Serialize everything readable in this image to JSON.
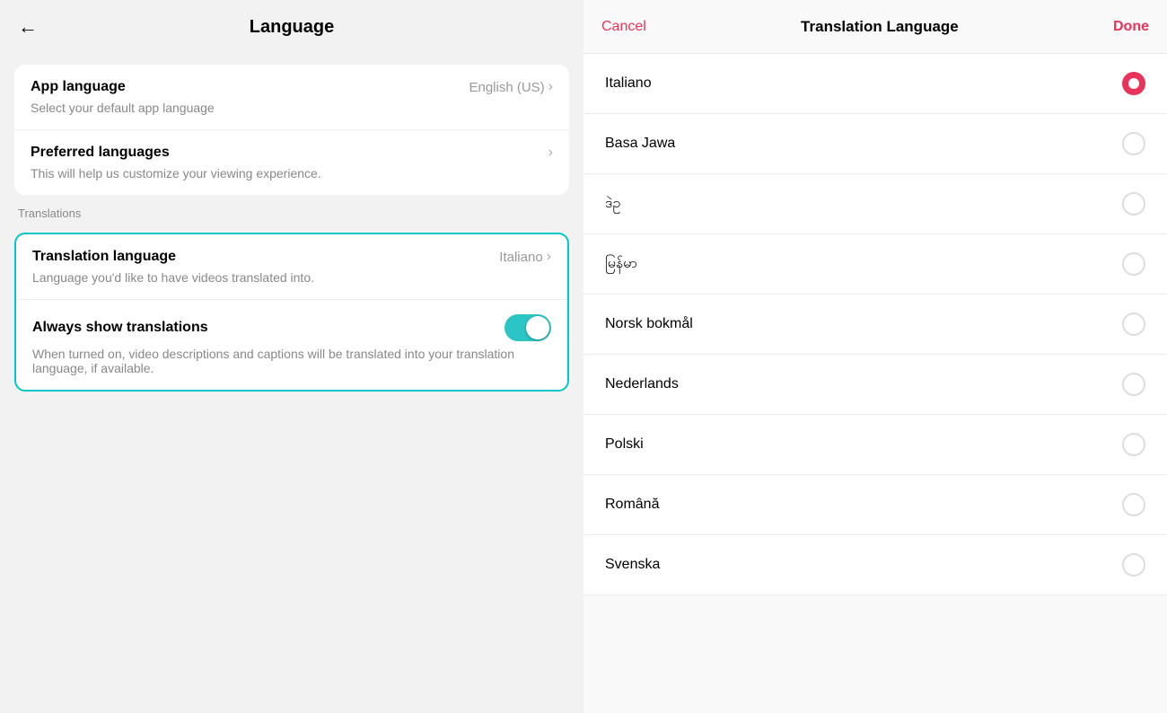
{
  "left": {
    "header": {
      "back_icon": "←",
      "title": "Language"
    },
    "app_language_card": {
      "title": "App language",
      "value": "English (US)",
      "description": "Select your default app language"
    },
    "preferred_languages_card": {
      "title": "Preferred languages",
      "description": "This will help us customize your viewing experience."
    },
    "translations_section_label": "Translations",
    "translation_language_item": {
      "title": "Translation language",
      "value": "Italiano",
      "description": "Language you'd like to have videos translated into."
    },
    "always_show_item": {
      "title": "Always show translations",
      "description": "When turned on, video descriptions and captions will be translated into your translation language, if available."
    }
  },
  "right": {
    "header": {
      "cancel_label": "Cancel",
      "title": "Translation Language",
      "done_label": "Done"
    },
    "languages": [
      {
        "name": "Italiano",
        "selected": true
      },
      {
        "name": "Basa Jawa",
        "selected": false
      },
      {
        "name": "ဒဲဥ",
        "selected": false
      },
      {
        "name": "မြန်မာ",
        "selected": false
      },
      {
        "name": "Norsk bokmål",
        "selected": false
      },
      {
        "name": "Nederlands",
        "selected": false
      },
      {
        "name": "Polski",
        "selected": false
      },
      {
        "name": "Română",
        "selected": false
      },
      {
        "name": "Svenska",
        "selected": false
      }
    ]
  }
}
